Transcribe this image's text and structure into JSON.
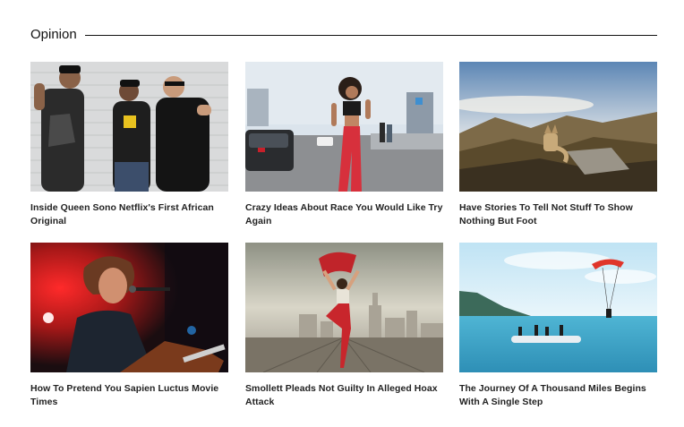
{
  "section": {
    "title": "Opinion"
  },
  "articles": [
    {
      "title": "Inside Queen Sono Netflix's First African Original"
    },
    {
      "title": "Crazy Ideas About Race You Would Like Try Again"
    },
    {
      "title": "Have Stories To Tell Not Stuff To Show Nothing But Foot"
    },
    {
      "title": "How To Pretend You Sapien Luctus Movie Times"
    },
    {
      "title": "Smollett Pleads Not Guilty In Alleged Hoax Attack"
    },
    {
      "title": "The Journey Of A Thousand Miles Begins With A Single Step"
    }
  ]
}
